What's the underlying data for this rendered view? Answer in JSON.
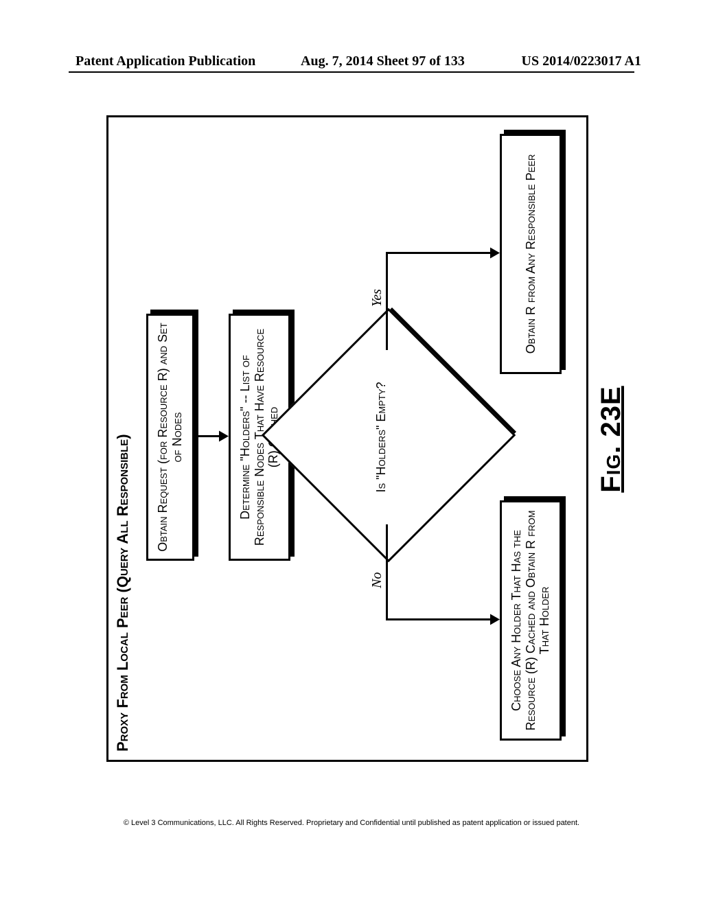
{
  "header": {
    "left": "Patent Application Publication",
    "center": "Aug. 7, 2014  Sheet 97 of 133",
    "right": "US 2014/0223017 A1"
  },
  "diagram": {
    "title": "Proxy From Local Peer (Query All Responsible)",
    "step_obtain": "Obtain Request (for Resource R) and Set of Nodes",
    "step_determine": "Determine \"Holders\" -- List of Responsible Nodes That Have Resource (R) Cached",
    "decision": "Is \"Holders\" Empty?",
    "label_no": "No",
    "label_yes": "Yes",
    "step_no": "Choose Any Holder That Has the Resource (R) Cached and Obtain R from That Holder",
    "step_yes": "Obtain R from Any Responsible Peer"
  },
  "figure_caption": "Fig. 23E",
  "footer": "© Level 3 Communications, LLC.  All Rights Reserved.  Proprietary and Confidential until published as patent application or issued patent.",
  "chart_data": {
    "type": "flowchart",
    "title": "Proxy From Local Peer (Query All Responsible)",
    "nodes": [
      {
        "id": "obtain",
        "kind": "process",
        "text": "Obtain Request (for Resource R) and Set of Nodes"
      },
      {
        "id": "determine",
        "kind": "process",
        "text": "Determine \"Holders\" -- List of Responsible Nodes That Have Resource (R) Cached"
      },
      {
        "id": "empty",
        "kind": "decision",
        "text": "Is \"Holders\" Empty?"
      },
      {
        "id": "no_path",
        "kind": "process",
        "text": "Choose Any Holder That Has the Resource (R) Cached and Obtain R from That Holder"
      },
      {
        "id": "yes_path",
        "kind": "process",
        "text": "Obtain R from Any Responsible Peer"
      }
    ],
    "edges": [
      {
        "from": "obtain",
        "to": "determine",
        "label": ""
      },
      {
        "from": "determine",
        "to": "empty",
        "label": ""
      },
      {
        "from": "empty",
        "to": "no_path",
        "label": "No"
      },
      {
        "from": "empty",
        "to": "yes_path",
        "label": "Yes"
      }
    ]
  }
}
